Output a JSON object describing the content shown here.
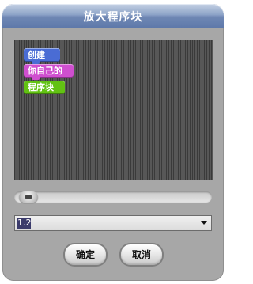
{
  "window": {
    "title": "放大程序块"
  },
  "blocks": [
    {
      "label": "创建",
      "color": "#4a6cd4"
    },
    {
      "label": "你自己的",
      "color": "#cf4fcf"
    },
    {
      "label": "程序块",
      "color": "#62c213"
    }
  ],
  "zoom": {
    "value": "1.2"
  },
  "buttons": {
    "ok": "确定",
    "cancel": "取消"
  }
}
